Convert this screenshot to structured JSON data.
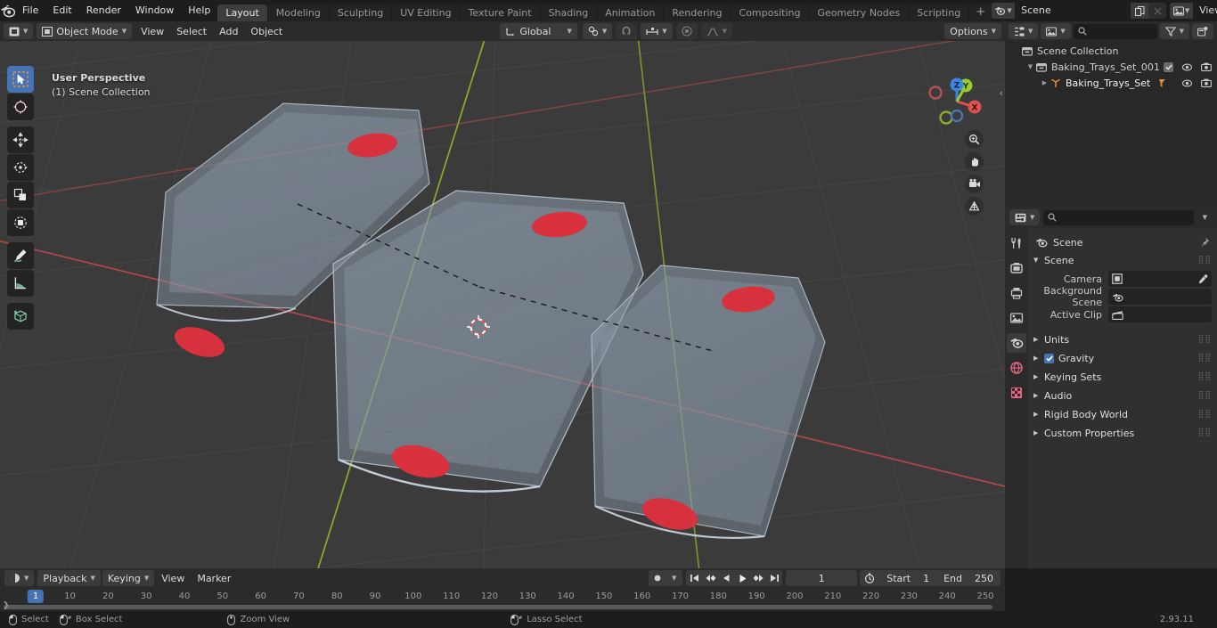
{
  "app": {
    "version": "2.93.11"
  },
  "topbar": {
    "menus": [
      "File",
      "Edit",
      "Render",
      "Window",
      "Help"
    ],
    "workspaces": [
      {
        "label": "Layout",
        "active": true
      },
      {
        "label": "Modeling",
        "active": false
      },
      {
        "label": "Sculpting",
        "active": false
      },
      {
        "label": "UV Editing",
        "active": false
      },
      {
        "label": "Texture Paint",
        "active": false
      },
      {
        "label": "Shading",
        "active": false
      },
      {
        "label": "Animation",
        "active": false
      },
      {
        "label": "Rendering",
        "active": false
      },
      {
        "label": "Compositing",
        "active": false
      },
      {
        "label": "Geometry Nodes",
        "active": false
      },
      {
        "label": "Scripting",
        "active": false
      }
    ],
    "add_workspace_label": "+",
    "scene_name": "Scene",
    "view_layer_name": "View Layer",
    "scene_icon": "scene-icon",
    "view_layer_icon": "view-layer-icon",
    "copy_icon": "duplicate-icon",
    "close_icon": "close-icon"
  },
  "viewport_header": {
    "editor_type_icon": "editor-type-icon",
    "mode_label": "Object Mode",
    "menus": [
      "View",
      "Select",
      "Add",
      "Object"
    ],
    "transform_orientation": "Global",
    "snap_icon": "magnet-icon",
    "proportional_icon": "proportional-edit-icon",
    "options_label": "Options",
    "select_modes": [
      "tweak",
      "box",
      "circle",
      "lasso"
    ],
    "shading_modes": [
      "wireframe",
      "solid",
      "material-preview",
      "rendered"
    ],
    "active_shading": "material-preview"
  },
  "viewport": {
    "perspective_label": "User Perspective",
    "collection_label": "(1) Scene Collection",
    "tools": [
      {
        "name": "tweak-select-tool",
        "active": true
      },
      {
        "name": "cursor-tool",
        "active": false
      },
      {
        "name": "move-tool",
        "active": false
      },
      {
        "name": "rotate-tool",
        "active": false
      },
      {
        "name": "scale-tool",
        "active": false
      },
      {
        "name": "transform-tool",
        "active": false
      },
      {
        "name": "annotate-tool",
        "active": false
      },
      {
        "name": "measure-tool",
        "active": false
      },
      {
        "name": "add-cube-tool",
        "active": false
      }
    ],
    "gizmo_axes": [
      "X",
      "Y",
      "Z"
    ],
    "nav_buttons": [
      "zoom-icon",
      "pan-icon",
      "camera-icon",
      "orthographic-icon"
    ],
    "colors": {
      "background": "#3b3b3b",
      "object_fill": "#9aa7b5",
      "marker_red": "#e03040",
      "axis_x_red": "#c24b4b",
      "axis_y_green": "#8fbd2a",
      "gizmo_x": "#e05252",
      "gizmo_y": "#99cc2a",
      "gizmo_z": "#3a86e0"
    }
  },
  "outliner": {
    "display_mode_icon": "outliner-display-icon",
    "filter_icon": "filter-icon",
    "new_collection_icon": "new-collection-icon",
    "search_placeholder": "",
    "rows": [
      {
        "label": "Scene Collection",
        "indent": 0,
        "icon": "collection-icon",
        "disclosure": "",
        "checkbox": false,
        "eye": false,
        "camera": false
      },
      {
        "label": "Baking_Trays_Set_001",
        "indent": 1,
        "icon": "collection-icon",
        "disclosure": "▼",
        "checkbox": true,
        "eye": true,
        "camera": true
      },
      {
        "label": "Baking_Trays_Set",
        "indent": 2,
        "icon": "empty-axes-icon",
        "disclosure": "▶",
        "checkbox": false,
        "eye": true,
        "camera": true,
        "badge": "modifier-icon"
      }
    ]
  },
  "properties": {
    "editor_icon": "properties-editor-icon",
    "search_placeholder": "",
    "breadcrumb": "Scene",
    "pin_icon": "pin-icon",
    "tabs": [
      {
        "name": "tool-tab",
        "active": false
      },
      {
        "name": "render-tab",
        "active": false
      },
      {
        "name": "output-tab",
        "active": false
      },
      {
        "name": "view-layer-tab",
        "active": false
      },
      {
        "name": "scene-tab",
        "active": true
      },
      {
        "name": "world-tab",
        "active": false
      },
      {
        "name": "texture-tab",
        "active": false
      }
    ],
    "panels": [
      {
        "label": "Scene",
        "open": true
      },
      {
        "label": "Units",
        "open": false
      },
      {
        "label": "Gravity",
        "open": false,
        "checkbox": true
      },
      {
        "label": "Keying Sets",
        "open": false
      },
      {
        "label": "Audio",
        "open": false
      },
      {
        "label": "Rigid Body World",
        "open": false
      },
      {
        "label": "Custom Properties",
        "open": false
      }
    ],
    "scene_fields": [
      {
        "label": "Camera",
        "value": "",
        "icon": "camera-data-icon",
        "eyedropper": true
      },
      {
        "label": "Background Scene",
        "value": "",
        "icon": "scene-icon",
        "eyedropper": false
      },
      {
        "label": "Active Clip",
        "value": "",
        "icon": "clip-icon",
        "eyedropper": false
      }
    ]
  },
  "timeline": {
    "editor_icon": "timeline-editor-icon",
    "menus": [
      "Playback",
      "Keying",
      "View",
      "Marker"
    ],
    "record_icon": "record-icon",
    "transport": [
      "jump-start-icon",
      "prev-keyframe-icon",
      "play-reverse-icon",
      "play-icon",
      "next-keyframe-icon",
      "jump-end-icon"
    ],
    "current_frame": "1",
    "use_preview_range_icon": "stopwatch-icon",
    "start_label": "Start",
    "start_value": "1",
    "end_label": "End",
    "end_value": "250",
    "ticks": [
      {
        "label": "1",
        "frame": 1
      },
      {
        "label": "10",
        "frame": 10
      },
      {
        "label": "20",
        "frame": 20
      },
      {
        "label": "30",
        "frame": 30
      },
      {
        "label": "40",
        "frame": 40
      },
      {
        "label": "50",
        "frame": 50
      },
      {
        "label": "60",
        "frame": 60
      },
      {
        "label": "70",
        "frame": 70
      },
      {
        "label": "80",
        "frame": 80
      },
      {
        "label": "90",
        "frame": 90
      },
      {
        "label": "100",
        "frame": 100
      },
      {
        "label": "110",
        "frame": 110
      },
      {
        "label": "120",
        "frame": 120
      },
      {
        "label": "130",
        "frame": 130
      },
      {
        "label": "140",
        "frame": 140
      },
      {
        "label": "150",
        "frame": 150
      },
      {
        "label": "160",
        "frame": 160
      },
      {
        "label": "170",
        "frame": 170
      },
      {
        "label": "180",
        "frame": 180
      },
      {
        "label": "190",
        "frame": 190
      },
      {
        "label": "200",
        "frame": 200
      },
      {
        "label": "210",
        "frame": 210
      },
      {
        "label": "220",
        "frame": 220
      },
      {
        "label": "230",
        "frame": 230
      },
      {
        "label": "240",
        "frame": 240
      },
      {
        "label": "250",
        "frame": 250
      }
    ],
    "playhead_label": "1"
  },
  "status_bar": {
    "items": [
      {
        "icon": "mouse-left-icon",
        "label": "Select"
      },
      {
        "icon": "mouse-left-drag-icon",
        "label": "Box Select"
      },
      {
        "icon": "mouse-middle-icon",
        "label": "Zoom View"
      },
      {
        "icon": "mouse-left-drag-icon",
        "label": "Lasso Select"
      }
    ],
    "version": "2.93.11"
  }
}
